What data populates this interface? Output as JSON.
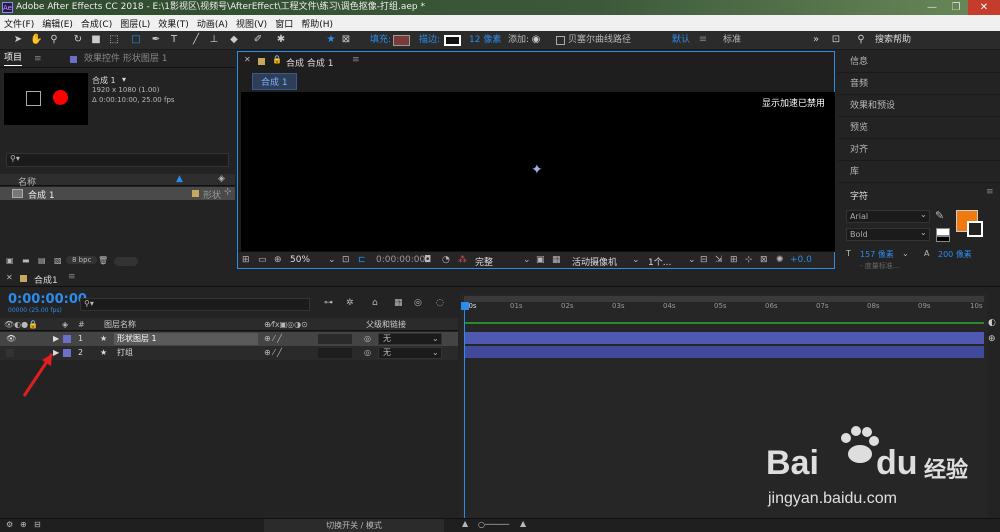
{
  "titlebar": {
    "text": "Adobe After Effects CC 2018 - E:\\1影视区\\视频号\\AfterEffect\\工程文件\\练习\\调色抠像-打组.aep *",
    "app_icon": "Ae",
    "minimize": "—",
    "maximize": "❐",
    "close": "✕"
  },
  "menu": [
    "文件(F)",
    "编辑(E)",
    "合成(C)",
    "图层(L)",
    "效果(T)",
    "动画(A)",
    "视图(V)",
    "窗口",
    "帮助(H)"
  ],
  "toolbar": {
    "fill_label": "填充:",
    "stroke_label": "描边:",
    "stroke_px": "12 像素",
    "add_label": "添加:",
    "bezier_label": "贝塞尔曲线路径",
    "default_label": "默认",
    "standard_label": "标准",
    "search_placeholder": "搜索帮助",
    "colors": {
      "fill": "#7a3a3a",
      "accent": "#2d8ceb"
    }
  },
  "project": {
    "tab": "项目",
    "effects_tab": "效果控件 形状图层 1",
    "comp_name": "合成 1",
    "comp_dim": "1920 x 1080 (1.00)",
    "comp_dur": "Δ 0:00:10:00, 25.00 fps",
    "col_name": "名称",
    "row_name": "合成 1",
    "row_type": "形状",
    "bpc": "8 bpc"
  },
  "composition": {
    "tab": "合成 合成 1",
    "sub_tab": "合成 1",
    "accel_text": "显示加速已禁用",
    "zoom": "50%",
    "timecode": "0:00:00:00",
    "quality": "完整",
    "camera": "活动摄像机",
    "views": "1个...",
    "exposure": "+0.0"
  },
  "right": {
    "items": [
      "信息",
      "音频",
      "效果和预设",
      "预览",
      "对齐",
      "库"
    ],
    "char_title": "字符",
    "font": "Arial",
    "style": "Bold",
    "size": "157 像素",
    "leading": "200 像素",
    "sub_hint": "- 度量标准..."
  },
  "timeline": {
    "tab": "合成1",
    "timecode": "0:00:00:00",
    "sub_timecode": "00000 (25.00 fps)",
    "col_layer": "图层名称",
    "col_parent": "父级和链接",
    "layers": [
      {
        "num": "1",
        "name": "形状图层 1",
        "parent": "无"
      },
      {
        "num": "2",
        "name": "打组",
        "parent": "无"
      }
    ],
    "ruler": [
      "00s",
      "01s",
      "02s",
      "03s",
      "04s",
      "05s",
      "06s",
      "07s",
      "08s",
      "09s",
      "10s"
    ]
  },
  "status": {
    "toggle_label": "切换开关 / 模式"
  },
  "watermark": {
    "brand": "Bai",
    "brand2": "du",
    "cn": "经验",
    "url": "jingyan.baidu.com"
  }
}
